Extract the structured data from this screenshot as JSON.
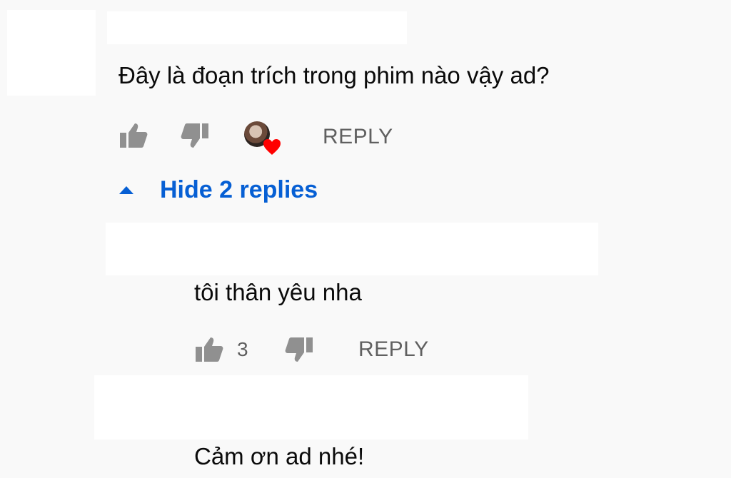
{
  "comment": {
    "text": "Đây là đoạn trích trong phim nào vậy ad?",
    "reply_label": "REPLY",
    "colors": {
      "heart": "#ff0000",
      "action_gray": "#909090"
    }
  },
  "replies_toggle": {
    "label": "Hide 2 replies",
    "icon": "caret-up-icon",
    "color": "#065fd4"
  },
  "replies": [
    {
      "text": "tôi thân yêu nha",
      "like_count": "3",
      "reply_label": "REPLY"
    },
    {
      "text": "Cảm ơn ad nhé!"
    }
  ]
}
